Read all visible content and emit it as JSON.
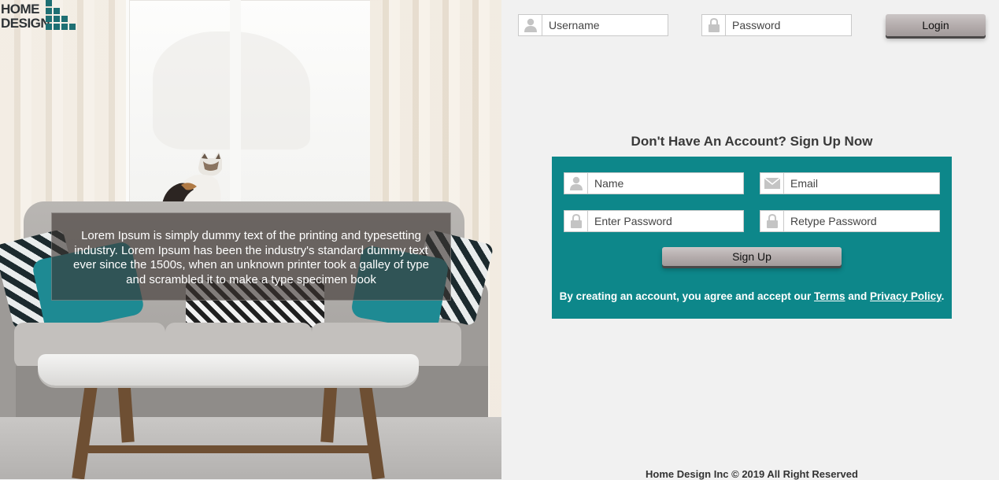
{
  "logo": {
    "line1": "HOME",
    "line2": "DESIGN"
  },
  "hero": {
    "overlay_text": "Lorem Ipsum is simply dummy text of the printing and typesetting industry. Lorem Ipsum has been the industry's standard dummy text ever since the 1500s, when an unknown printer took a galley of type and scrambled it to make a type specimen book"
  },
  "login": {
    "username_placeholder": "Username",
    "password_placeholder": "Password",
    "button_label": "Login"
  },
  "signup": {
    "title": "Don't Have An Account? Sign Up Now",
    "name_placeholder": "Name",
    "email_placeholder": "Email",
    "password_placeholder": "Enter Password",
    "retype_placeholder": "Retype Password",
    "button_label": "Sign Up",
    "terms_prefix": "By creating an account, you agree and accept our ",
    "terms_link": "Terms",
    "terms_and": " and ",
    "privacy_link": "Privacy Policy",
    "terms_suffix": "."
  },
  "footer": {
    "text": "Home Design Inc © 2019 All Right Reserved"
  },
  "colors": {
    "teal": "#0d878a",
    "page_bg": "#f1f1f1",
    "icon_gray": "#c4c4c4"
  },
  "icons": {
    "user": "user-icon",
    "lock": "lock-icon",
    "mail": "envelope-icon"
  }
}
